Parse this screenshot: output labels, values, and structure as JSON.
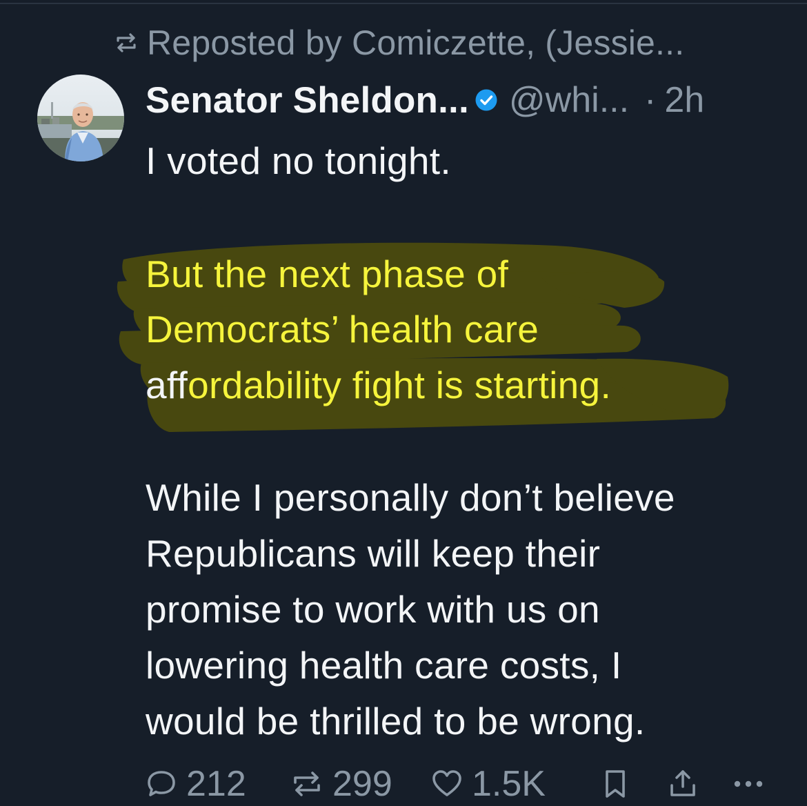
{
  "repost": {
    "label": "Reposted by Comiczette, (Jessie...",
    "icon": "repost-icon"
  },
  "author": {
    "display_name": "Senator Sheldon...",
    "handle": "@whi...",
    "separator": "·",
    "time": "2h",
    "verified_icon": "verified-badge-icon",
    "badge_color": "#1d9bf0"
  },
  "post": {
    "line1": "I voted no tonight.",
    "highlighted_lines": [
      {
        "pre": "But the next phase of",
        "post": ""
      },
      {
        "pre": "Democrats’ health care",
        "post": ""
      },
      {
        "pre": "aff",
        "post": "ordability fight is starting."
      }
    ],
    "paragraph3": [
      "While I personally don’t believe",
      "Republicans will keep their",
      "promise to work with us on",
      "lowering health care costs, I",
      "would be thrilled to be wrong."
    ]
  },
  "actions": {
    "replies": "212",
    "reposts": "299",
    "likes": "1.5K",
    "icons": [
      "reply-icon",
      "repost-icon",
      "like-icon",
      "bookmark-icon",
      "share-icon",
      "more-icon"
    ]
  },
  "colors": {
    "background": "#161e29",
    "text": "#f3f5f7",
    "muted": "#8b98a5",
    "highlight_text": "#f6f43c",
    "highlighter": "#5b5a10"
  }
}
